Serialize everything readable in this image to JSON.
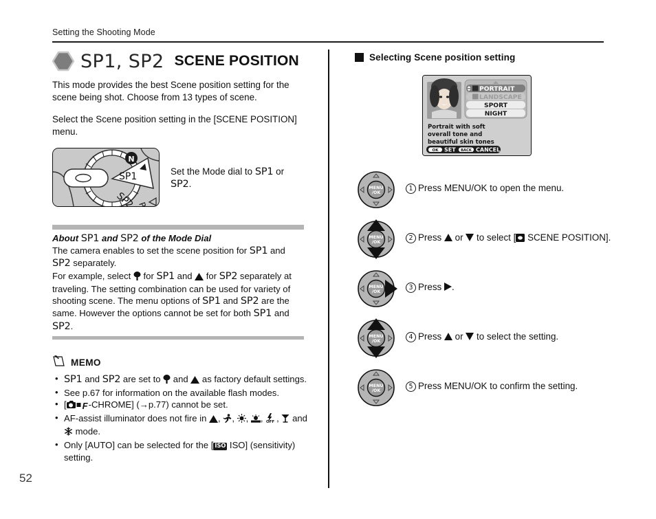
{
  "page": {
    "running_head": "Setting the Shooting Mode",
    "page_number": "52"
  },
  "left": {
    "heading": {
      "mode_marks": "SP1, SP2",
      "title": "SCENE POSITION",
      "icon": "hexagon-mode-icon"
    },
    "intro": "This mode provides the best Scene position setting for the scene being shot. Choose from 13 types of scene.",
    "instruction": "Select the Scene position setting in the [SCENE POSITION] menu.",
    "dial_figure": {
      "label_sp1": "SP1",
      "label_sp2": "SP2",
      "label_n": "N",
      "label_p": "P"
    },
    "dial_caption_pre": "Set the Mode dial to ",
    "dial_caption_sp1": "SP1",
    "dial_caption_mid": " or ",
    "dial_caption_sp2": "SP2",
    "dial_caption_post": ".",
    "about": {
      "title_pre": "About ",
      "title_sp1": "SP1",
      "title_mid": " and ",
      "title_sp2": "SP2",
      "title_post": " of the Mode Dial",
      "line1_a": "The camera enables to set the scene position for ",
      "line1_sp1": "SP1",
      "line1_b": " and ",
      "line1_sp2": "SP2",
      "line1_c": " separately.",
      "line2_a": "For example, select ",
      "line2_glyph1": "tree-icon",
      "line2_b": " for ",
      "line2_sp1": "SP1",
      "line2_c": " and ",
      "line2_glyph2": "mountain-icon",
      "line2_d": " for ",
      "line2_sp2": "SP2",
      "line2_e": " separately at traveling. The setting combination can be used for variety of shooting scene. The menu options of ",
      "line2_sp3": "SP1",
      "line2_f": " and ",
      "line2_sp4": "SP2",
      "line2_g": " are the same. However the options cannot be set for both ",
      "line2_sp5": "SP1",
      "line2_h": " and ",
      "line2_sp6": "SP2",
      "line2_i": "."
    },
    "memo": {
      "icon": "memo-note-icon",
      "label": "MEMO",
      "items": [
        {
          "a": "SP1",
          "b": " and ",
          "c": "SP2",
          "d": " are set to ",
          "glyph1": "tree-icon",
          "e": " and ",
          "glyph2": "mountain-icon",
          "f": " as factory default settings."
        },
        {
          "text": "See p.67 for information on the available flash modes."
        },
        {
          "pre": "[",
          "chip": "F",
          "mid": "-CHROME] (→p.77) cannot be set."
        },
        {
          "pre": "AF-assist illuminator does not fire in ",
          "glyphs": [
            "mountain-icon",
            "sport-runner-icon",
            "fireworks-icon",
            "sunset-icon",
            "flash-off-icon",
            "cocktail-glass-icon",
            "snowflake-icon"
          ],
          "post": " mode.",
          "joiner": ", ",
          "last_joiner": " and "
        },
        {
          "pre": "Only [AUTO] can be selected for the [",
          "chip": "ISO",
          "mid": " ISO] (sensitivity) setting."
        }
      ]
    }
  },
  "right": {
    "section_title": "Selecting Scene position setting",
    "lcd": {
      "menu_items": [
        {
          "label": "PORTRAIT",
          "icon": "portrait-icon",
          "state": "selected"
        },
        {
          "label": "LANDSCAPE",
          "icon": "landscape-icon",
          "state": "dimmed"
        },
        {
          "label": "SPORT",
          "icon": "",
          "state": "normal"
        },
        {
          "label": "NIGHT",
          "icon": "",
          "state": "normal"
        }
      ],
      "description": [
        "Portrait with soft",
        "overall tone and",
        "beautiful skin tones"
      ],
      "footer": [
        {
          "key": "OK",
          "action": "SET"
        },
        {
          "key": "BACK",
          "action": "CANCEL"
        }
      ],
      "thumbnail": "portrait-photo-thumbnail"
    },
    "steps": [
      {
        "num": "①",
        "pad": "menu-ok-pad",
        "highlight": "center",
        "parts": [
          {
            "t": "Press MENU/OK to open the menu."
          }
        ]
      },
      {
        "num": "②",
        "pad": "menu-ok-pad",
        "highlight": "updown",
        "parts": [
          {
            "t": "Press "
          },
          {
            "glyph": "triangle-up-icon"
          },
          {
            "t": " or "
          },
          {
            "glyph": "triangle-down-icon"
          },
          {
            "t": " to select ["
          },
          {
            "chip": "scene-position-icon"
          },
          {
            "t": " SCENE POSITION]."
          }
        ]
      },
      {
        "num": "③",
        "pad": "menu-ok-pad",
        "highlight": "right",
        "parts": [
          {
            "t": "Press "
          },
          {
            "glyph": "triangle-right-icon"
          },
          {
            "t": "."
          }
        ]
      },
      {
        "num": "④",
        "pad": "menu-ok-pad",
        "highlight": "updown",
        "parts": [
          {
            "t": "Press "
          },
          {
            "glyph": "triangle-up-icon"
          },
          {
            "t": " or "
          },
          {
            "glyph": "triangle-down-icon"
          },
          {
            "t": " to select the setting."
          }
        ]
      },
      {
        "num": "⑤",
        "pad": "menu-ok-pad",
        "highlight": "center",
        "parts": [
          {
            "t": "Press MENU/OK to confirm the setting."
          }
        ]
      }
    ],
    "pad_label_line1": "MENU",
    "pad_label_line2": "/OK"
  },
  "colors": {
    "ink": "#111111",
    "rule": "#1a1a1a",
    "grey_bar": "#b4b4b4",
    "dial_body": "#c9c9c9",
    "lcd_body": "#cfcfcf",
    "hex_icon": "#808080"
  }
}
